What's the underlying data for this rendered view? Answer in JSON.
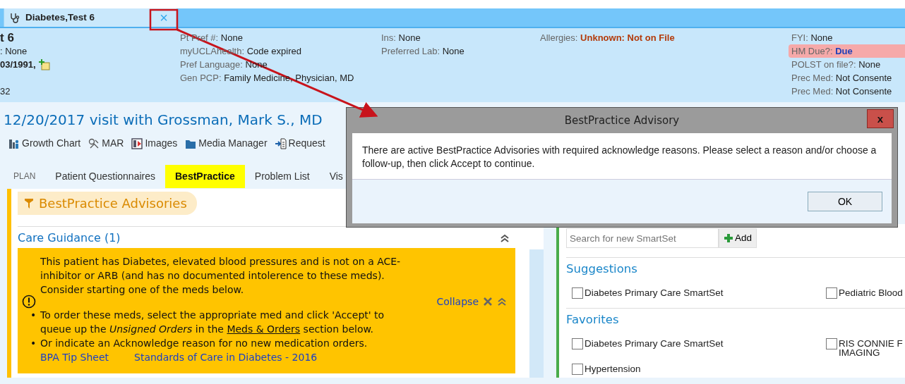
{
  "patient_tab": {
    "label": "Diabetes,Test 6",
    "close": "×"
  },
  "header": {
    "columns": [
      {
        "items": [
          {
            "kind": "name",
            "text": "t 6"
          },
          {
            "kind": "plain",
            "text": ": None"
          },
          {
            "kind": "dob",
            "text": "03/1991,"
          },
          {
            "kind": "spaced",
            "text": "32"
          }
        ]
      },
      {
        "items": [
          {
            "kind": "field",
            "label": "Pt Pref #:",
            "value": "None"
          },
          {
            "kind": "field",
            "label": "myUCLAhealth:",
            "value": "Code expired"
          },
          {
            "kind": "field",
            "label": "Pref Language:",
            "value": "None"
          },
          {
            "kind": "field",
            "label": "Gen PCP:",
            "value": "Family Medicine, Physician, MD"
          }
        ]
      },
      {
        "items": [
          {
            "kind": "field",
            "label": "Ins:",
            "value": "None"
          },
          {
            "kind": "field",
            "label": "Preferred Lab:",
            "value": "None"
          }
        ]
      },
      {
        "items": [
          {
            "kind": "alert",
            "label": "Allergies:",
            "value": "Unknown: Not on File"
          }
        ]
      },
      {
        "items": [
          {
            "kind": "field",
            "label": "FYI:",
            "value": "None"
          },
          {
            "kind": "highlight",
            "label": "HM Due?:",
            "value": "Due"
          },
          {
            "kind": "field",
            "label": "POLST on file?:",
            "value": "None"
          },
          {
            "kind": "field",
            "label": "Prec Med:",
            "value": "Not Consente"
          },
          {
            "kind": "field",
            "label": "Prec Med:",
            "value": "Not Consente"
          }
        ]
      }
    ]
  },
  "visit_title": "12/20/2017 visit with Grossman, Mark S., MD",
  "toolbar": [
    {
      "kind": "chart",
      "label": "Growth Chart"
    },
    {
      "kind": "mar",
      "label": "MAR"
    },
    {
      "kind": "images",
      "label": "Images"
    },
    {
      "kind": "folder",
      "label": "Media Manager"
    },
    {
      "kind": "request",
      "label": "Request"
    }
  ],
  "tabs": {
    "section": "PLAN",
    "items": [
      {
        "label": "Patient Questionnaires",
        "selected": false
      },
      {
        "label": "BestPractice",
        "selected": true
      },
      {
        "label": "Problem List",
        "selected": false
      },
      {
        "label": "Vis",
        "selected": false
      }
    ]
  },
  "advisories": {
    "title": "BestPractice Advisories",
    "group": "Care Guidance (1)",
    "intro": "This patient has Diabetes, elevated blood pressures and is not on a ACE-inhibitor or ARB (and has no documented intolerence to these meds). Consider starting one of the meds below.",
    "bullets": [
      {
        "marker": "•",
        "before": "To order these meds, select the appropriate med and click 'Accept' to queue up the *Unsigned Orders* in the ",
        "link": "Meds & Orders",
        "after": " section below."
      },
      {
        "marker": "•",
        "before": "Or indicate an Acknowledge reason for no new medication orders."
      }
    ],
    "links": [
      "BPA Tip Sheet",
      "Standards of Care in Diabetes - 2016"
    ],
    "collapse": "Collapse"
  },
  "smartsets": {
    "search": {
      "placeholder": "Search for new SmartSet"
    },
    "add": "Add",
    "sections": [
      {
        "title": "Suggestions",
        "items": [
          {
            "label": "Diabetes Primary Care SmartSet",
            "checked": false
          },
          {
            "label": "Pediatric Blood",
            "checked": false
          }
        ]
      },
      {
        "title": "Favorites",
        "items": [
          {
            "label": "Diabetes Primary Care SmartSet",
            "checked": false
          },
          {
            "label": "RIS CONNIE F\nIMAGING",
            "checked": false
          },
          {
            "label": "Hypertension",
            "checked": false
          }
        ]
      }
    ]
  },
  "dialog": {
    "title": "BestPractice Advisory",
    "close": "x",
    "message": "There are active BestPractice Advisories with required acknowledge reasons. Please select a reason and/or choose a follow-up, then click Accept to continue.",
    "ok": "OK"
  }
}
